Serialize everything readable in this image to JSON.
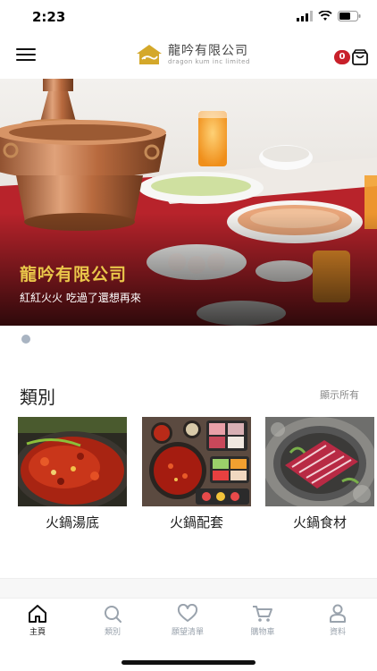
{
  "status_bar": {
    "time": "2:23"
  },
  "header": {
    "brand_name": "龍吟有限公司",
    "brand_subtitle": "dragon kum inc limited",
    "cart_count": "0"
  },
  "hero": {
    "title": "龍吟有限公司",
    "subtitle": "紅紅火火 吃過了還想再來"
  },
  "categories": {
    "title": "類別",
    "show_all": "顯示所有",
    "items": [
      {
        "label": "火鍋湯底"
      },
      {
        "label": "火鍋配套"
      },
      {
        "label": "火鍋食材"
      }
    ]
  },
  "tab_bar": {
    "items": [
      {
        "label": "主頁",
        "icon": "home-icon",
        "active": true
      },
      {
        "label": "類別",
        "icon": "search-icon",
        "active": false
      },
      {
        "label": "願望清單",
        "icon": "heart-icon",
        "active": false
      },
      {
        "label": "購物車",
        "icon": "cart-icon",
        "active": false
      },
      {
        "label": "資料",
        "icon": "user-icon",
        "active": false
      }
    ]
  },
  "colors": {
    "accent_red": "#c8202a",
    "hero_title_gold": "#e9c64a",
    "logo_gold": "#d4a82a"
  }
}
